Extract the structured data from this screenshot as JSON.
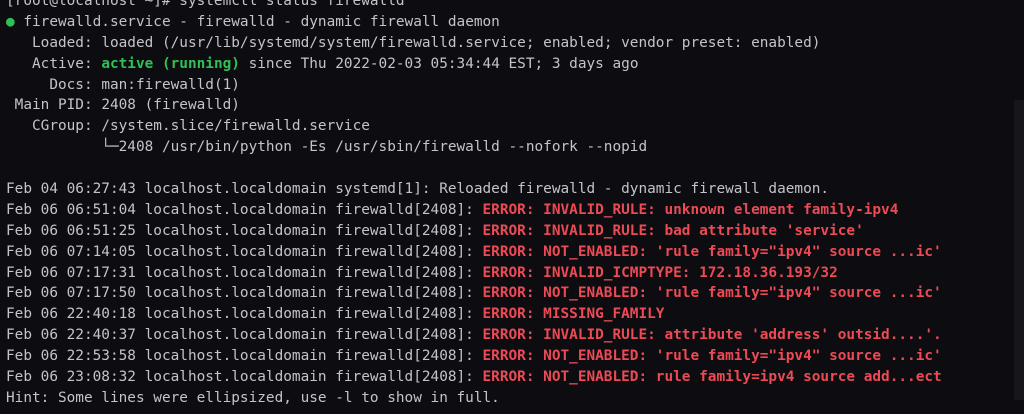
{
  "terminal": {
    "prompt_line": "[root@localhost ~]# systemctl status firewalld",
    "unit_bullet": "●",
    "unit_line": " firewalld.service - firewalld - dynamic firewall daemon",
    "loaded_label": "   Loaded: ",
    "loaded_value": "loaded (/usr/lib/systemd/system/firewalld.service; enabled; vendor preset: enabled)",
    "active_label": "   Active: ",
    "active_state": "active (running)",
    "active_rest": " since Thu 2022-02-03 05:34:44 EST; 3 days ago",
    "docs_label": "     Docs: ",
    "docs_value": "man:firewalld(1)",
    "pid_label": " Main PID: ",
    "pid_value": "2408 (firewalld)",
    "cgroup_label": "   CGroup: ",
    "cgroup_value": "/system.slice/firewalld.service",
    "cgroup_child": "           └─2408 /usr/bin/python -Es /usr/sbin/firewalld --nofork --nopid",
    "log_lines": [
      {
        "prefix": "Feb 04 06:27:43 localhost.localdomain systemd[1]: Reloaded firewalld - dynamic firewall daemon.",
        "error_label": "",
        "error_text": ""
      },
      {
        "prefix": "Feb 06 06:51:04 localhost.localdomain firewalld[2408]: ",
        "error_label": "ERROR:",
        "error_text": " INVALID_RULE: unknown element family-ipv4"
      },
      {
        "prefix": "Feb 06 06:51:25 localhost.localdomain firewalld[2408]: ",
        "error_label": "ERROR:",
        "error_text": " INVALID_RULE: bad attribute 'service'"
      },
      {
        "prefix": "Feb 06 07:14:05 localhost.localdomain firewalld[2408]: ",
        "error_label": "ERROR:",
        "error_text": " NOT_ENABLED: 'rule family=\"ipv4\" source ...ic'"
      },
      {
        "prefix": "Feb 06 07:17:31 localhost.localdomain firewalld[2408]: ",
        "error_label": "ERROR:",
        "error_text": " INVALID_ICMPTYPE: 172.18.36.193/32"
      },
      {
        "prefix": "Feb 06 07:17:50 localhost.localdomain firewalld[2408]: ",
        "error_label": "ERROR:",
        "error_text": " NOT_ENABLED: 'rule family=\"ipv4\" source ...ic'"
      },
      {
        "prefix": "Feb 06 22:40:18 localhost.localdomain firewalld[2408]: ",
        "error_label": "ERROR:",
        "error_text": " MISSING_FAMILY"
      },
      {
        "prefix": "Feb 06 22:40:37 localhost.localdomain firewalld[2408]: ",
        "error_label": "ERROR:",
        "error_text": " INVALID_RULE: attribute 'address' outsid....'."
      },
      {
        "prefix": "Feb 06 22:53:58 localhost.localdomain firewalld[2408]: ",
        "error_label": "ERROR:",
        "error_text": " NOT_ENABLED: 'rule family=\"ipv4\" source ...ic'"
      },
      {
        "prefix": "Feb 06 23:08:32 localhost.localdomain firewalld[2408]: ",
        "error_label": "ERROR:",
        "error_text": " NOT_ENABLED: rule family=ipv4 source add...ect"
      }
    ],
    "hint_line": "Hint: Some lines were ellipsized, use -l to show in full."
  },
  "colors": {
    "background": "#0c0c11",
    "text": "#c3c3cb",
    "active_green": "#2fc155",
    "error_red": "#ec4a55"
  }
}
